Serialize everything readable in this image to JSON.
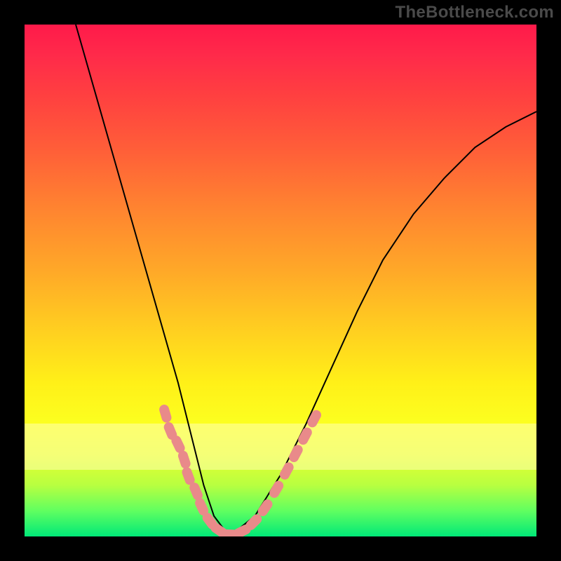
{
  "watermark": "TheBottleneck.com",
  "chart_data": {
    "type": "line",
    "title": "",
    "xlabel": "",
    "ylabel": "",
    "xlim": [
      0,
      1
    ],
    "ylim": [
      0,
      1
    ],
    "grid": false,
    "legend": false,
    "series": [
      {
        "name": "curve",
        "color": "#000000",
        "x": [
          0.1,
          0.14,
          0.18,
          0.22,
          0.26,
          0.3,
          0.33,
          0.35,
          0.37,
          0.4,
          0.45,
          0.5,
          0.55,
          0.6,
          0.65,
          0.7,
          0.76,
          0.82,
          0.88,
          0.94,
          1.0
        ],
        "y": [
          1.0,
          0.86,
          0.72,
          0.58,
          0.44,
          0.3,
          0.18,
          0.1,
          0.04,
          0.0,
          0.04,
          0.12,
          0.22,
          0.33,
          0.44,
          0.54,
          0.63,
          0.7,
          0.76,
          0.8,
          0.83
        ]
      }
    ],
    "markers": [
      {
        "name": "pink-segments",
        "color": "#e98a8a",
        "points": [
          {
            "x": 0.275,
            "y": 0.24
          },
          {
            "x": 0.285,
            "y": 0.206
          },
          {
            "x": 0.3,
            "y": 0.18
          },
          {
            "x": 0.312,
            "y": 0.15
          },
          {
            "x": 0.32,
            "y": 0.118
          },
          {
            "x": 0.335,
            "y": 0.088
          },
          {
            "x": 0.346,
            "y": 0.058
          },
          {
            "x": 0.362,
            "y": 0.03
          },
          {
            "x": 0.38,
            "y": 0.012
          },
          {
            "x": 0.4,
            "y": 0.004
          },
          {
            "x": 0.425,
            "y": 0.01
          },
          {
            "x": 0.448,
            "y": 0.028
          },
          {
            "x": 0.47,
            "y": 0.056
          },
          {
            "x": 0.492,
            "y": 0.092
          },
          {
            "x": 0.512,
            "y": 0.128
          },
          {
            "x": 0.53,
            "y": 0.162
          },
          {
            "x": 0.548,
            "y": 0.196
          },
          {
            "x": 0.566,
            "y": 0.23
          }
        ]
      }
    ],
    "background_gradient": {
      "stops": [
        {
          "pos": 0.0,
          "color": "#ff1a4a"
        },
        {
          "pos": 0.5,
          "color": "#ffb028"
        },
        {
          "pos": 0.8,
          "color": "#fff820"
        },
        {
          "pos": 1.0,
          "color": "#00e878"
        }
      ]
    },
    "highlight_band": {
      "y0": 0.13,
      "y1": 0.22,
      "color": "#ffffb0"
    }
  }
}
